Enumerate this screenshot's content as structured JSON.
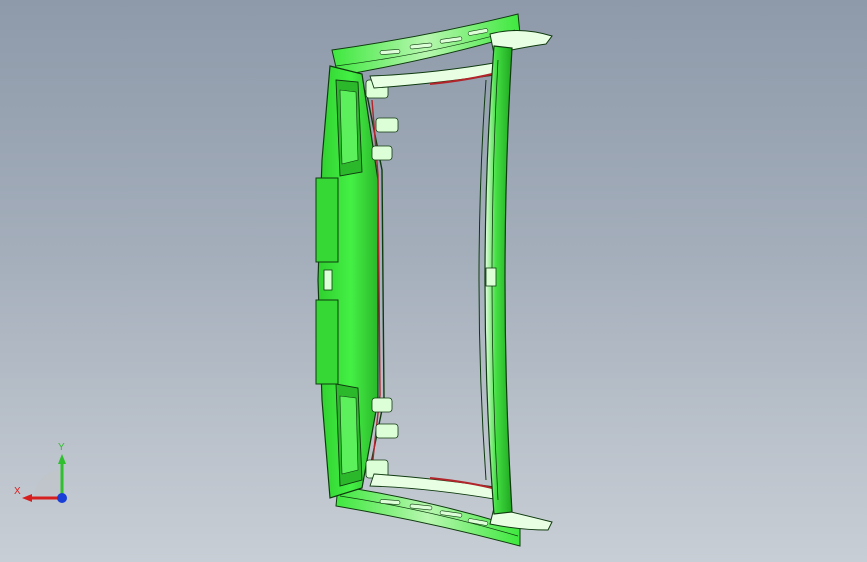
{
  "viewport": {
    "background_top": "#8e9aaa",
    "background_bottom": "#c8ced5"
  },
  "model": {
    "body_color": "#3ee83e",
    "highlight_color": "#dcffd8",
    "edge_color": "#0f3a0f",
    "accent_color": "#b0242a"
  },
  "triad": {
    "x_label": "X",
    "y_label": "Y",
    "x_color": "#d62020",
    "y_color": "#2fbf2f",
    "z_color": "#1a3fd6"
  }
}
